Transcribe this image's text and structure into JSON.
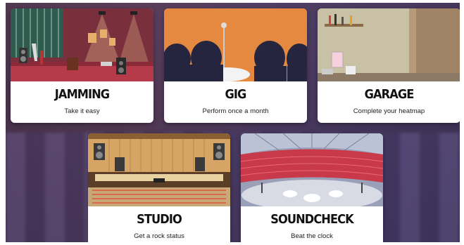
{
  "cards": [
    {
      "title": "JAMMING",
      "subtitle": "Take it easy",
      "illustration": "stage-with-guitars"
    },
    {
      "title": "GIG",
      "subtitle": "Perform once a month",
      "illustration": "crowd-silhouettes-microphone"
    },
    {
      "title": "GARAGE",
      "subtitle": "Complete your heatmap",
      "illustration": "garage-tools-paint-cans"
    },
    {
      "title": "STUDIO",
      "subtitle": "Get a rock status",
      "illustration": "recording-studio-console"
    },
    {
      "title": "SOUNDCHECK",
      "subtitle": "Beat the clock",
      "illustration": "arena-red-seats"
    }
  ],
  "colors": {
    "jamming_bg": "#7a2f3c",
    "gig_bg": "#e07d3c",
    "garage_bg": "#b79a7a",
    "studio_bg": "#d6a464",
    "soundcheck_bg": "#c8394a"
  }
}
